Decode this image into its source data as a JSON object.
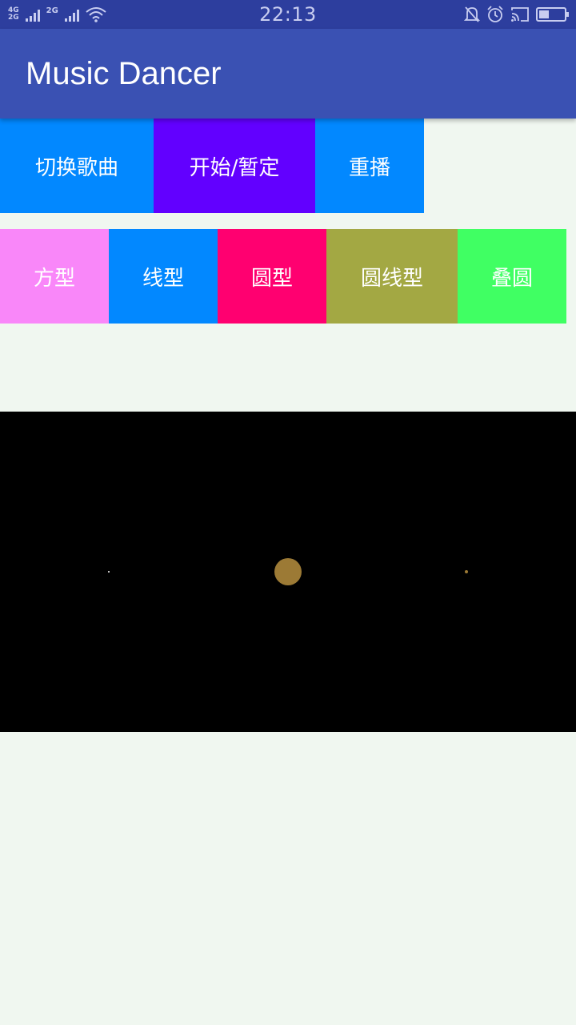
{
  "status_bar": {
    "time": "22:13",
    "network_1_top": "4G",
    "network_1_bottom": "2G",
    "network_2": "2G",
    "icons": [
      "signal-icon",
      "wifi-icon",
      "mute-bell-icon",
      "alarm-icon",
      "cast-icon",
      "battery-icon"
    ],
    "battery_level": 0.35
  },
  "app_bar": {
    "title": "Music Dancer",
    "color": "#3a51b3"
  },
  "controls": {
    "switch_song": {
      "label": "切换歌曲",
      "color": "#0288ff"
    },
    "play_pause": {
      "label": "开始/暂定",
      "color": "#6200ff"
    },
    "replay": {
      "label": "重播",
      "color": "#0288ff"
    }
  },
  "modes": [
    {
      "label": "方型",
      "color": "#f987f9"
    },
    {
      "label": "线型",
      "color": "#0288ff"
    },
    {
      "label": "圆型",
      "color": "#ff0070"
    },
    {
      "label": "圆线型",
      "color": "#a3a843"
    },
    {
      "label": "叠圆",
      "color": "#40ff63"
    }
  ],
  "visualizer": {
    "background": "#000000",
    "orb_color": "#9c7a35"
  }
}
